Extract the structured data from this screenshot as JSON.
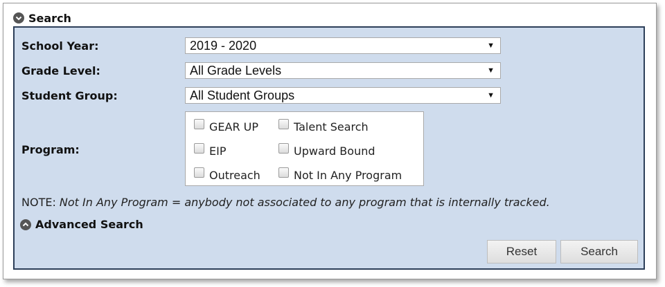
{
  "section": {
    "title": "Search"
  },
  "fields": {
    "school_year": {
      "label": "School Year:",
      "value": "2019 - 2020"
    },
    "grade_level": {
      "label": "Grade Level:",
      "value": "All Grade Levels"
    },
    "student_group": {
      "label": "Student Group:",
      "value": "All Student Groups"
    }
  },
  "program": {
    "label": "Program:",
    "options": [
      "GEAR UP",
      "Talent Search",
      "EIP",
      "Upward Bound",
      "Outreach",
      "Not In Any Program"
    ]
  },
  "note": {
    "prefix": "NOTE: ",
    "text": "Not In Any Program = anybody not associated to any program that is internally tracked."
  },
  "advanced": {
    "label": "Advanced Search"
  },
  "buttons": {
    "reset": "Reset",
    "search": "Search"
  },
  "colors": {
    "panel_bg": "#cfdced",
    "panel_border": "#2c3e58",
    "icon": "#555555"
  }
}
